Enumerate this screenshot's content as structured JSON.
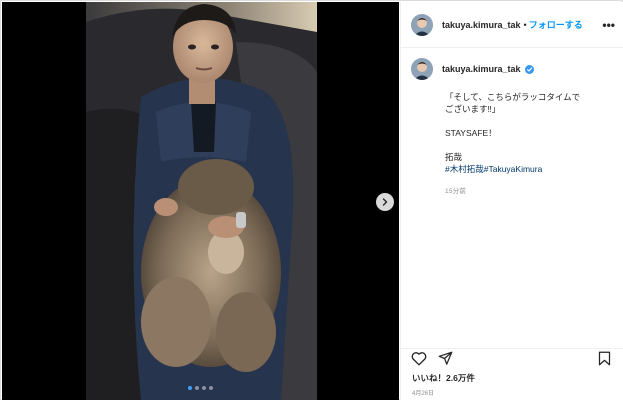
{
  "post": {
    "username": "takuya.kimura_tak",
    "header_separator": "•",
    "follow_label": "フォローする",
    "more_label": "•••",
    "caption": {
      "lines": [
        "「そして、こちらがラッコタイムで",
        "ございます‼」"
      ],
      "line2": "STAYSAFE！",
      "line3": "拓哉",
      "hashtags": [
        "#木村拓哉",
        "#TakuyaKimura"
      ]
    },
    "time_ago": "15分前",
    "likes": "いいね！2.6万件",
    "date": "4月26日"
  },
  "carousel": {
    "slide_count": 4,
    "active_index": 0
  },
  "colors": {
    "accent": "#0095f6",
    "verified": "#3897f0",
    "hashtag": "#00376b",
    "muted": "#8e8e8e"
  },
  "icons": {
    "next": "chevron-right-icon",
    "like": "heart-outline-icon",
    "share": "paper-plane-icon",
    "save": "bookmark-icon",
    "verified": "verified-badge-icon",
    "more": "more-dots-icon"
  }
}
